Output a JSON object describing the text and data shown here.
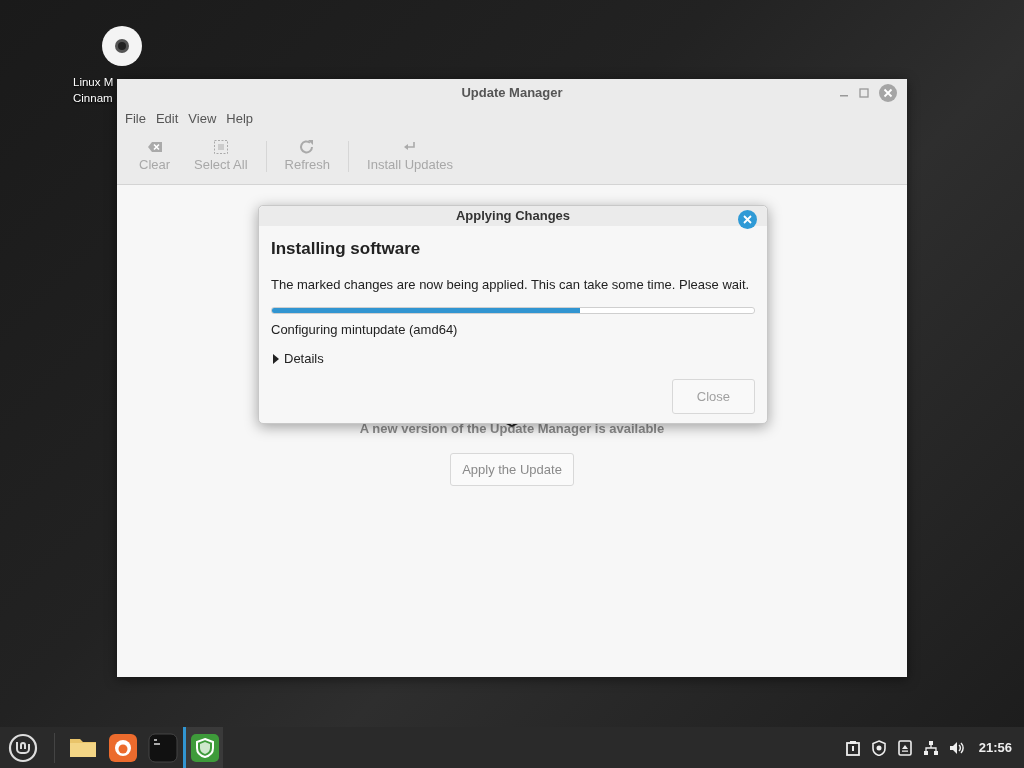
{
  "desktop_icons": [
    {
      "label_lines": [
        "Linux M",
        "Cinnam"
      ]
    }
  ],
  "window": {
    "title": "Update Manager",
    "menu": [
      "File",
      "Edit",
      "View",
      "Help"
    ],
    "toolbar": [
      {
        "kind": "clear",
        "label": "Clear",
        "disabled": true
      },
      {
        "kind": "select",
        "label": "Select All",
        "disabled": true
      },
      {
        "kind": "refresh",
        "label": "Refresh",
        "disabled": true
      },
      {
        "kind": "install",
        "label": "Install Updates",
        "disabled": true
      }
    ],
    "message": "A new version of the Update Manager is available",
    "apply_button": "Apply the Update"
  },
  "dialog": {
    "title": "Applying Changes",
    "heading": "Installing software",
    "message": "The marked changes are now being applied. This can take some time. Please wait.",
    "progress": {
      "level": 0.64
    },
    "status": "Configuring mintupdate (amd64)",
    "details": {
      "label": "Details",
      "expanded": false
    },
    "close_button": {
      "label": "Close",
      "disabled": true
    }
  },
  "taskbar": {
    "apps": [
      {
        "kind": "files",
        "active": false
      },
      {
        "kind": "firefox",
        "active": false
      },
      {
        "kind": "terminal",
        "active": false
      },
      {
        "kind": "shield",
        "active": true
      }
    ],
    "clock": "21:56"
  }
}
